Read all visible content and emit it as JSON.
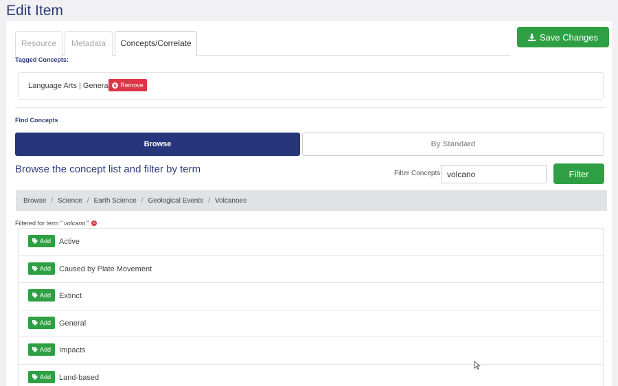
{
  "page": {
    "title": "Edit Item"
  },
  "tabs": [
    {
      "label": "Resource",
      "active": false
    },
    {
      "label": "Metadata",
      "active": false
    },
    {
      "label": "Concepts/Correlate",
      "active": true
    }
  ],
  "toolbar": {
    "save_label": "Save Changes",
    "save_icon": "download-icon"
  },
  "tagged": {
    "heading": "Tagged Concepts:",
    "items": [
      {
        "label": "Language Arts | General",
        "remove_label": "Remove"
      }
    ]
  },
  "find": {
    "heading": "Find Concepts",
    "browse_label": "Browse",
    "standard_label": "By Standard",
    "browse_heading": "Browse the concept list and filter by term",
    "filter_label": "Filter Concepts",
    "filter_value": "volcano",
    "filter_button": "Filter"
  },
  "breadcrumb": [
    "Browse",
    "Science",
    "Earth Science",
    "Geological Events",
    "Volcanoes"
  ],
  "filter_note": {
    "prefix": "Filtered for term \"",
    "term": "volcano",
    "suffix": "\""
  },
  "concepts": [
    {
      "add_label": "Add",
      "label": "Active"
    },
    {
      "add_label": "Add",
      "label": "Caused by Plate Movement"
    },
    {
      "add_label": "Add",
      "label": "Extinct"
    },
    {
      "add_label": "Add",
      "label": "General"
    },
    {
      "add_label": "Add",
      "label": "Impacts"
    },
    {
      "add_label": "Add",
      "label": "Land-based"
    }
  ],
  "colors": {
    "primary": "#27367a",
    "success": "#2ea043",
    "danger": "#dc3545",
    "title": "#2c3a7a"
  }
}
